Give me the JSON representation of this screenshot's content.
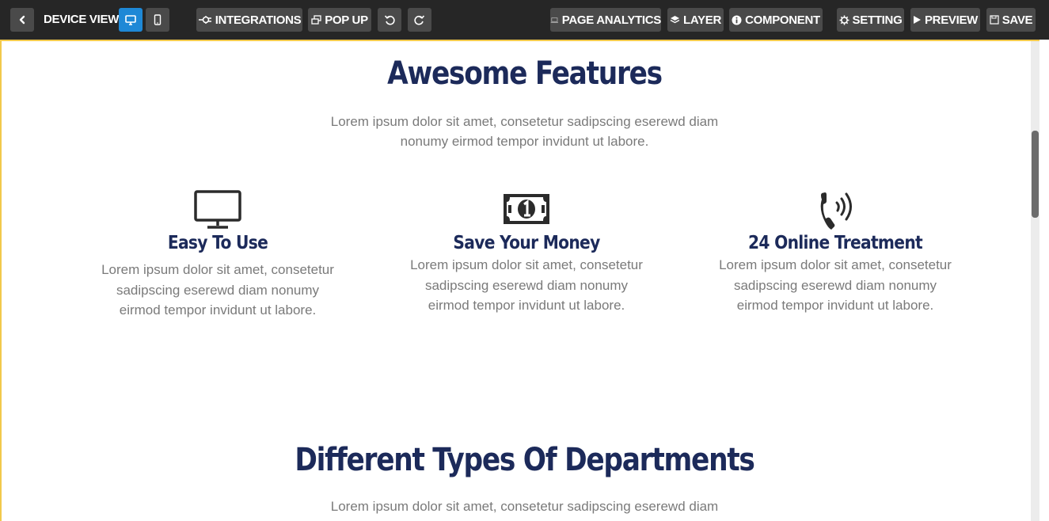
{
  "toolbar": {
    "back_icon": "chevron-left-icon",
    "device_view_label": "DEVICE VIEW :",
    "desktop_icon": "monitor-icon",
    "mobile_icon": "phone-icon",
    "integrations_label": "INTEGRATIONS",
    "integrations_icon": "plug-icon",
    "popup_label": "POP UP",
    "popup_icon": "windows-icon",
    "undo_icon": "undo-icon",
    "redo_icon": "redo-icon",
    "analytics_label": "PAGE ANALYTICS",
    "analytics_icon": "laptop-icon",
    "layer_label": "LAYER",
    "layer_icon": "layers-icon",
    "component_label": "COMPONENT",
    "component_icon": "info-icon",
    "setting_label": "SETTING",
    "setting_icon": "gear-icon",
    "preview_label": "PREVIEW",
    "preview_icon": "play-icon",
    "save_label": "SAVE",
    "save_icon": "floppy-icon",
    "active_color": "#1e88d6"
  },
  "page": {
    "features_title": "Awesome Features",
    "features_lead": [
      "Lorem ipsum dolor sit amet, consetetur sadipscing eserewd diam",
      "nonumy eirmod tempor invidunt ut labore."
    ],
    "features": [
      {
        "icon": "desktop-icon",
        "title": "Easy To Use",
        "text": [
          "Lorem ipsum dolor sit amet, consetetur",
          "sadipscing eserewd diam nonumy",
          "eirmod tempor invidunt ut labore."
        ]
      },
      {
        "icon": "money-bill-icon",
        "title": "Save Your Money",
        "text": [
          "Lorem ipsum dolor sit amet, consetetur",
          "sadipscing eserewd diam nonumy",
          "eirmod tempor invidunt ut labore."
        ]
      },
      {
        "icon": "phone-volume-icon",
        "title": "24 Online Treatment",
        "text": [
          "Lorem ipsum dolor sit amet, consetetur",
          "sadipscing eserewd diam nonumy",
          "eirmod tempor invidunt ut labore."
        ]
      }
    ],
    "departments_title": "Different Types Of Departments",
    "departments_lead": [
      "Lorem ipsum dolor sit amet, consetetur sadipscing eserewd diam"
    ],
    "heading_color": "#1c2a5a",
    "body_text_color": "#7a7a7a",
    "selection_border_color": "#f2c94c"
  }
}
